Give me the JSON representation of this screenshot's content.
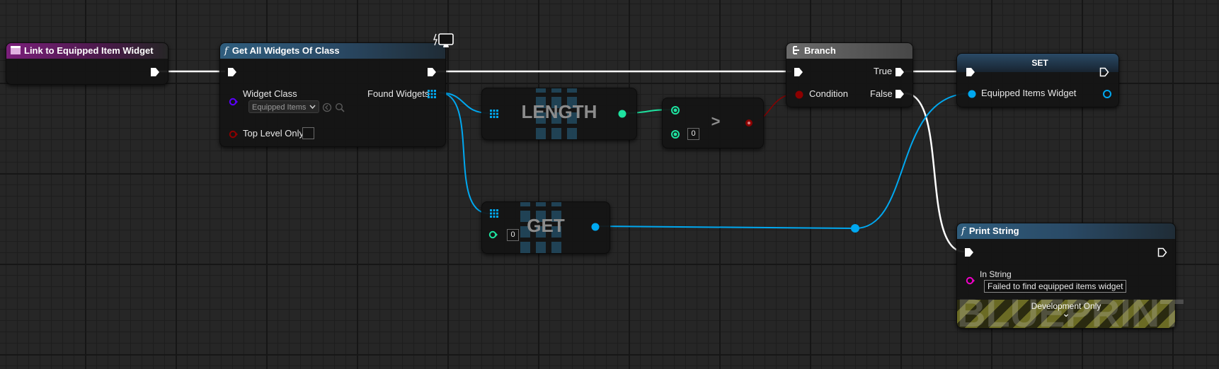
{
  "nodes": {
    "event": {
      "title": "Link to Equipped Item Widget"
    },
    "get_all_widgets": {
      "title": "Get All Widgets Of Class",
      "function_glyph": "f",
      "widget_class_label": "Widget Class",
      "widget_class_value": "Equipped Items",
      "found_widgets_label": "Found Widgets",
      "top_level_only_label": "Top Level Only"
    },
    "length": {
      "title": "LENGTH"
    },
    "greater": {
      "operator": ">",
      "value": "0"
    },
    "branch": {
      "title": "Branch",
      "condition_label": "Condition",
      "true_label": "True",
      "false_label": "False"
    },
    "set": {
      "title": "SET",
      "variable_label": "Equipped Items Widget"
    },
    "get": {
      "title": "GET",
      "index_value": "0"
    },
    "print_string": {
      "title": "Print String",
      "function_glyph": "f",
      "in_string_label": "In String",
      "in_string_value": "Failed to find equipped items widget",
      "dev_only_label": "Development Only",
      "expand_glyph": "⌄"
    }
  },
  "watermark": "BLUEPRINT",
  "colors": {
    "exec": "#ffffff",
    "object": "#00a8f0",
    "integer": "#1ee3a0",
    "bool": "#8c0000",
    "class": "#5b00ff",
    "string": "#f000c8"
  }
}
